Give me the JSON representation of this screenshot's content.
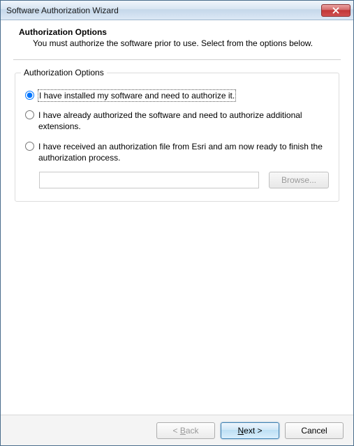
{
  "window": {
    "title": "Software Authorization Wizard"
  },
  "header": {
    "title": "Authorization Options",
    "subtitle": "You must authorize the software prior to use. Select from the options below."
  },
  "group": {
    "label": "Authorization Options",
    "options": [
      {
        "label": "I have installed my software and need to authorize it.",
        "selected": true
      },
      {
        "label": "I have already authorized the software and need to authorize additional extensions.",
        "selected": false
      },
      {
        "label": "I have received an authorization file from Esri and am now ready to finish the authorization process.",
        "selected": false
      }
    ],
    "file_value": "",
    "browse_label": "Browse..."
  },
  "footer": {
    "back": "< Back",
    "back_letter": "B",
    "next": "Next >",
    "next_letter": "N",
    "cancel": "Cancel"
  }
}
